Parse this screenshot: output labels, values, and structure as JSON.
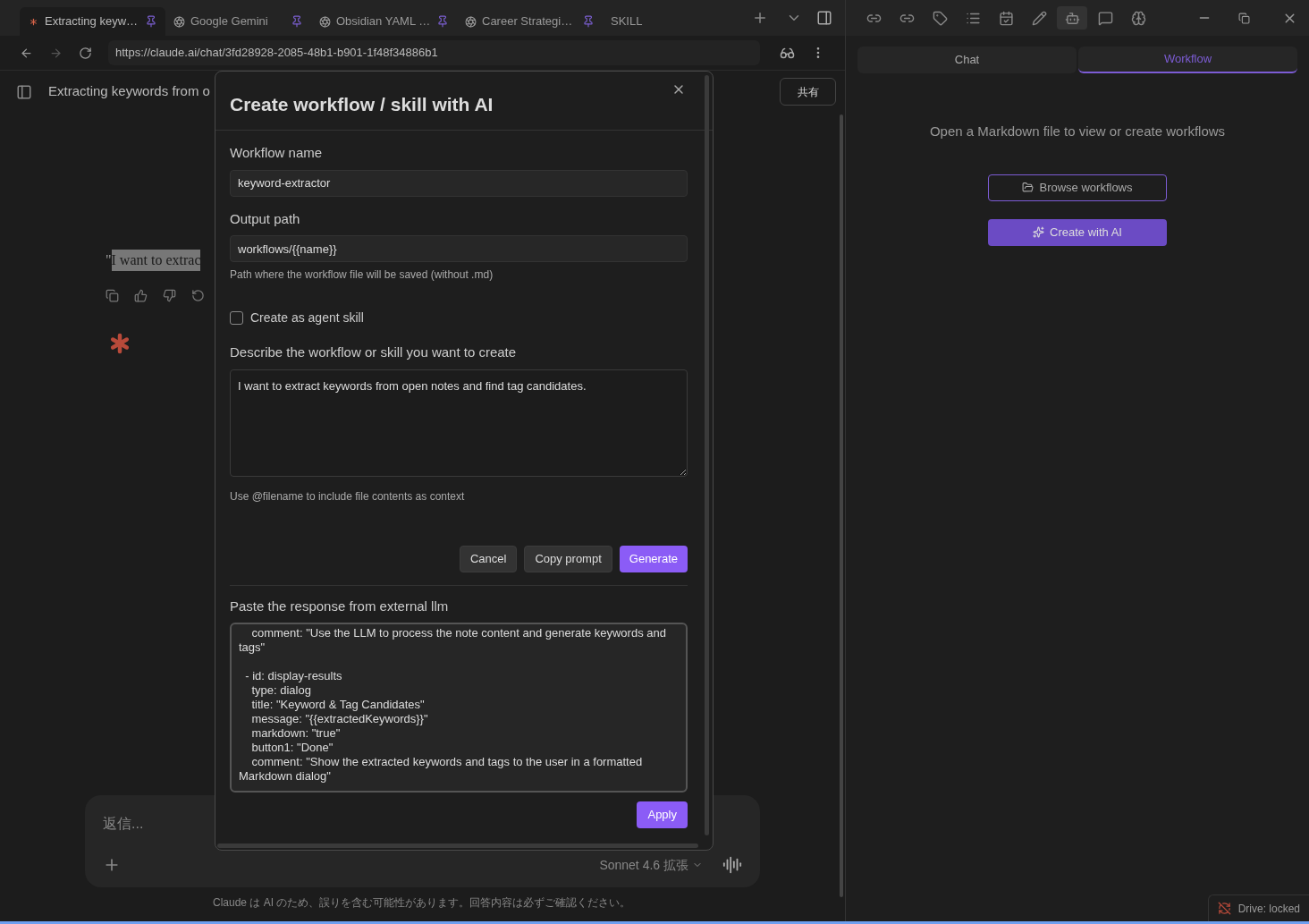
{
  "browser": {
    "tabs": [
      {
        "title": "Extracting keyw…",
        "pinned": true,
        "selected": true,
        "kind": "claude"
      },
      {
        "title": "Google Gemini",
        "pinned": true,
        "selected": false,
        "kind": "web"
      },
      {
        "title": "Obsidian YAML …",
        "pinned": true,
        "selected": false,
        "kind": "web"
      },
      {
        "title": "Career Strategi…",
        "pinned": true,
        "selected": false,
        "kind": "web"
      },
      {
        "title": "SKILL",
        "pinned": false,
        "selected": false,
        "kind": "none"
      }
    ],
    "url": "https://claude.ai/chat/3fd28928-2085-48b1-b901-1f48f34886b1"
  },
  "chat": {
    "title": "Extracting keywords from o",
    "share": "共有",
    "quote_mark": "\"",
    "quote": "I want to extrac",
    "composer": {
      "placeholder": "返信...",
      "model": "Sonnet 4.6",
      "mode": "拡張"
    },
    "disclaimer": "Claude は AI のため、誤りを含む可能性があります。回答内容は必ずご確認ください。"
  },
  "dialog": {
    "title": "Create workflow / skill with AI",
    "name_label": "Workflow name",
    "name_value": "keyword-extractor",
    "path_label": "Output path",
    "path_value": "workflows/{{name}}",
    "path_hint": "Path where the workflow file will be saved (without .md)",
    "agent_skill": {
      "label": "Create as agent skill",
      "checked": false
    },
    "describe_label": "Describe the workflow or skill you want to create",
    "describe_value": "I want to extract keywords from open notes and find tag candidates.",
    "describe_hint": "Use @filename to include file contents as context",
    "buttons": [
      {
        "label": "Cancel",
        "kind": "secondary"
      },
      {
        "label": "Copy prompt",
        "kind": "secondary"
      },
      {
        "label": "Generate",
        "kind": "primary"
      }
    ],
    "paste_label": "Paste the response from external llm",
    "paste_value": "    comment: \"Use the LLM to process the note content and generate keywords and tags\"\n\n  - id: display-results\n    type: dialog\n    title: \"Keyword & Tag Candidates\"\n    message: \"{{extractedKeywords}}\"\n    markdown: \"true\"\n    button1: \"Done\"\n    comment: \"Show the extracted keywords and tags to the user in a formatted Markdown dialog\"",
    "apply": "Apply"
  },
  "ribbon": [
    {
      "selected": false
    },
    {
      "selected": false
    },
    {
      "selected": false
    },
    {
      "selected": false
    },
    {
      "selected": false
    },
    {
      "selected": false
    },
    {
      "selected": true
    },
    {
      "selected": false
    },
    {
      "selected": false
    }
  ],
  "panel": {
    "tabs": [
      {
        "label": "Chat",
        "selected": false
      },
      {
        "label": "Workflow",
        "selected": true
      }
    ],
    "message": "Open a Markdown file to view or create workflows",
    "browse": "Browse workflows",
    "create": "Create with AI"
  },
  "status_bar": {
    "drive": "Drive: locked"
  }
}
